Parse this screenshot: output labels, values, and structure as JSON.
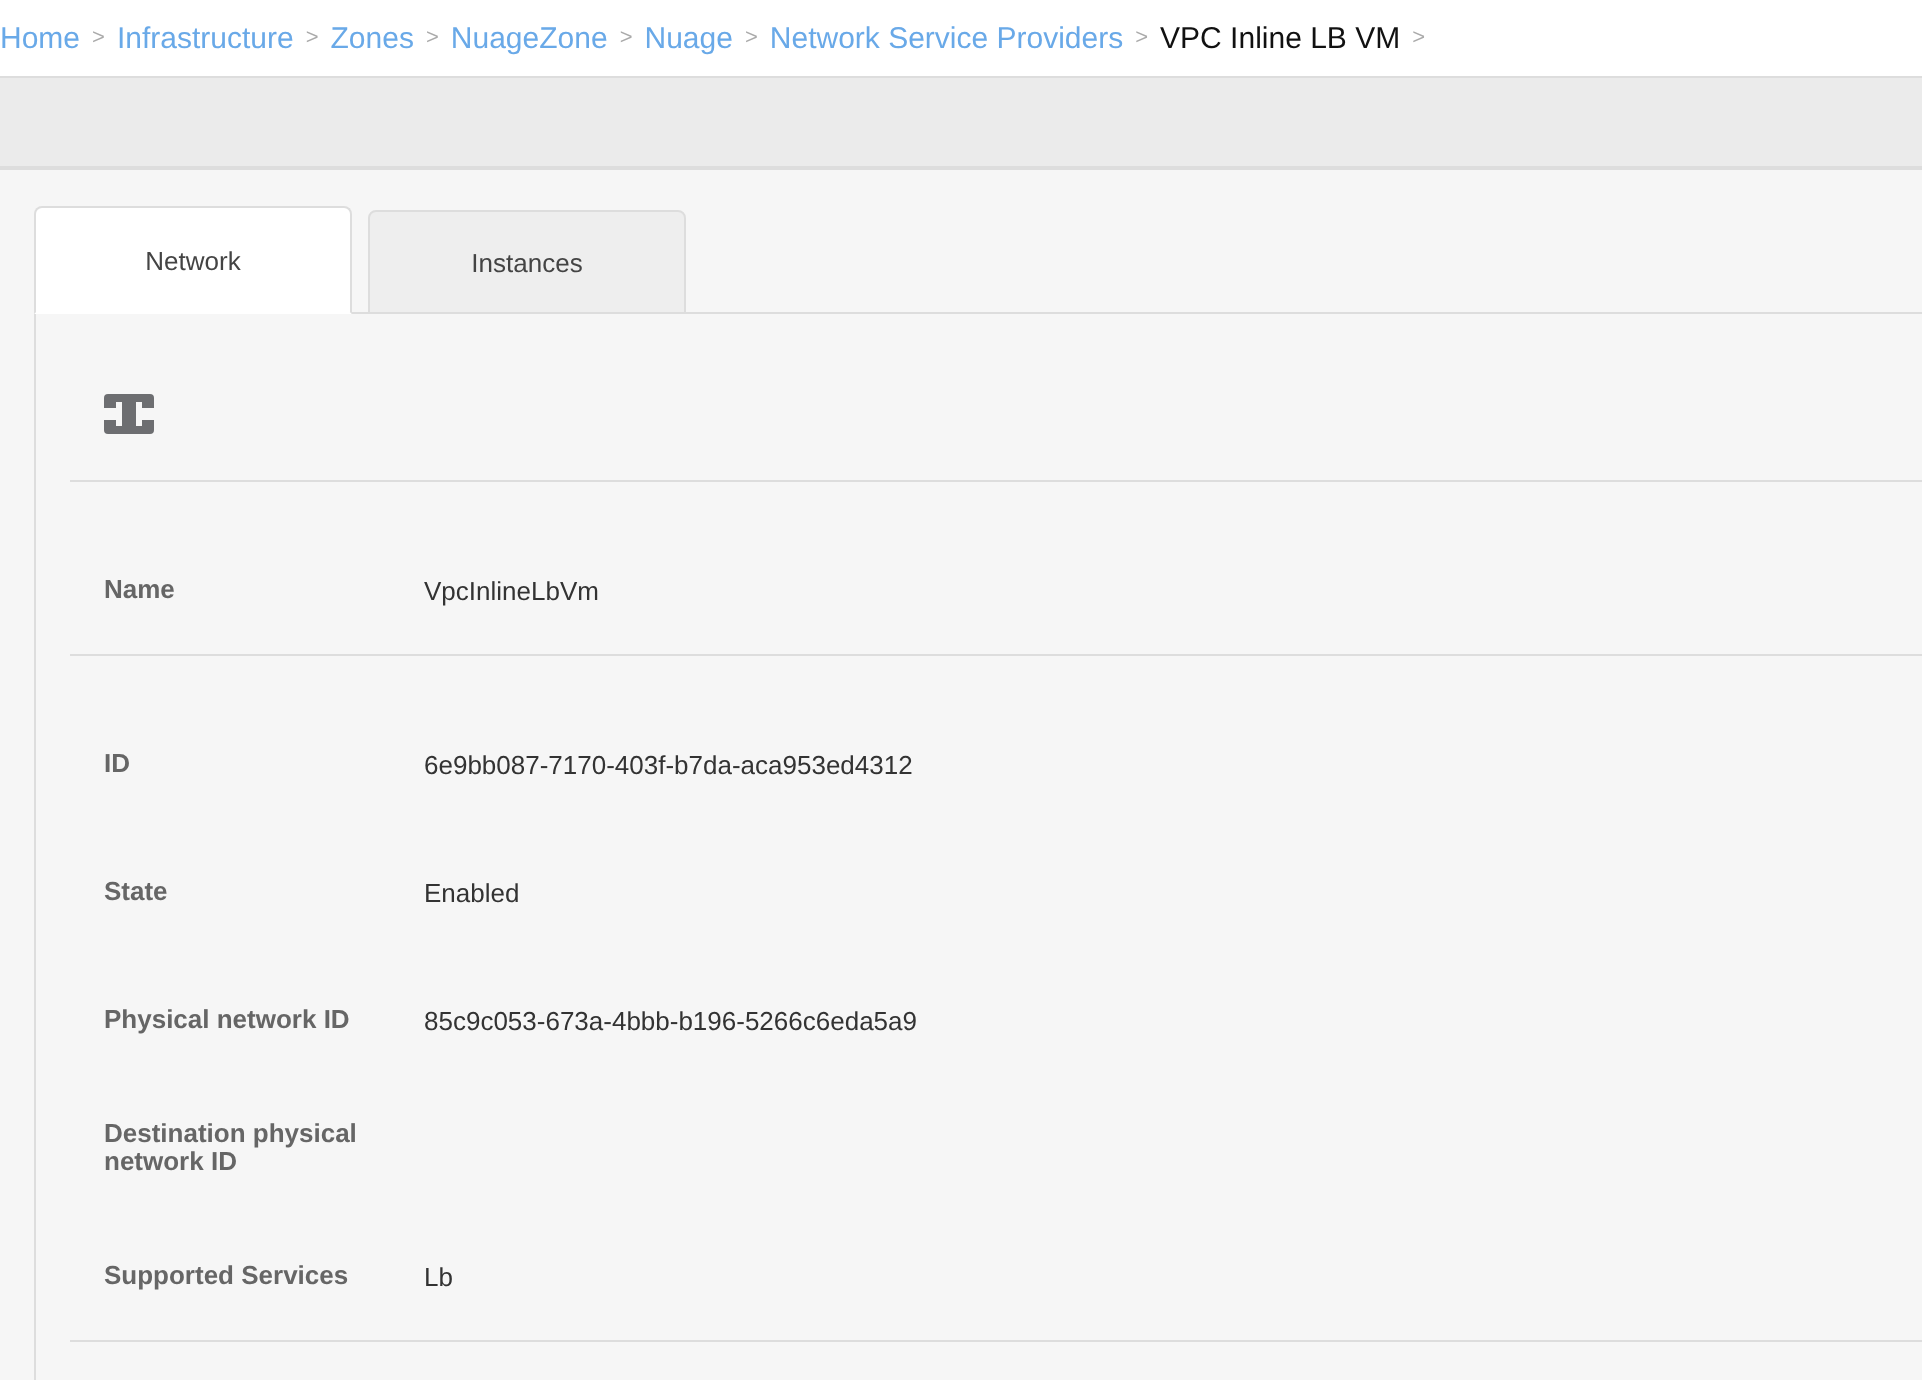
{
  "breadcrumb": [
    {
      "label": "Home",
      "current": false,
      "separator": ">"
    },
    {
      "label": "Infrastructure",
      "current": false,
      "separator": ">"
    },
    {
      "label": "Zones",
      "current": false,
      "separator": ">"
    },
    {
      "label": "NuageZone",
      "current": false,
      "separator": ">"
    },
    {
      "label": "Nuage",
      "current": false,
      "separator": ">"
    },
    {
      "label": "Network Service Providers",
      "current": false,
      "separator": ">"
    },
    {
      "label": "VPC Inline LB VM",
      "current": true,
      "separator": ">"
    }
  ],
  "tabs": [
    {
      "label": "Network",
      "selected": true
    },
    {
      "label": "Instances",
      "selected": false
    }
  ],
  "details": [
    {
      "rows": [
        {
          "label": "Name",
          "value": "VpcInlineLbVm"
        }
      ]
    },
    {
      "rows": [
        {
          "label": "ID",
          "value": "6e9bb087-7170-403f-b7da-aca953ed4312"
        },
        {
          "label": "State",
          "value": "Enabled"
        },
        {
          "label": "Physical network ID",
          "value": "85c9c053-673a-4bbb-b196-5266c6eda5a9"
        },
        {
          "label": "Destination physical network ID"
        },
        {
          "label": "Supported Services",
          "value": "Lb"
        }
      ]
    }
  ]
}
